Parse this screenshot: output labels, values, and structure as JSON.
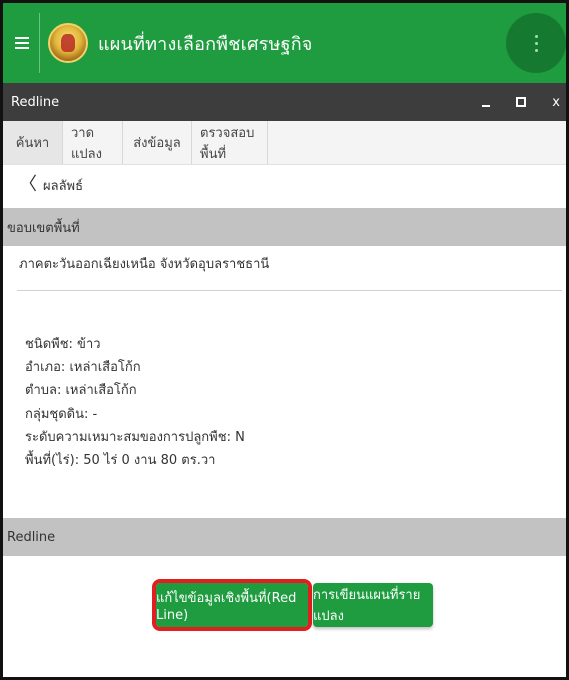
{
  "app": {
    "title": "แผนที่ทางเลือกพืชเศรษฐกิจ",
    "menu_icon": "hamburger-icon",
    "logo": "agency-logo",
    "overflow_icon": "kebab-menu-icon"
  },
  "window": {
    "title": "Redline",
    "minimize_label": "_",
    "close_label": "x"
  },
  "tabs": [
    {
      "label": "ค้นหา",
      "active": true
    },
    {
      "label": "วาดแปลง",
      "active": false
    },
    {
      "label": "ส่งข้อมูล",
      "active": false
    },
    {
      "label": "ตรวจสอบพื้นที่",
      "active": false
    }
  ],
  "nav": {
    "back_label": "ผลลัพธ์"
  },
  "boundary": {
    "header": "ขอบเขตพื้นที่",
    "region": "ภาคตะวันออกเฉียงเหนือ จังหวัดอุบลราชธานี"
  },
  "details": {
    "crop": "ชนิดพืช: ข้าว",
    "district": "อำเภอ: เหล่าเสือโก้ก",
    "subdistrict": "ตำบล: เหล่าเสือโก้ก",
    "soil_group": "กลุ่มชุดดิน: -",
    "suitability": "ระดับความเหมาะสมของการปลูกพืช: N",
    "area": "พื้นที่(ไร่): 50 ไร่ 0 งาน 80 ตร.วา"
  },
  "redline_section": {
    "header": "Redline",
    "edit_button": "แก้ไขข้อมูลเชิงพื้นที่(Red Line)",
    "plan_button": "การเขียนแผนที่รายแปลง"
  },
  "colors": {
    "brand_green": "#1e9c3f",
    "window_bar": "#3d3d3d",
    "section_gray": "#c2c2c2",
    "highlight_red": "#e01f1f"
  }
}
